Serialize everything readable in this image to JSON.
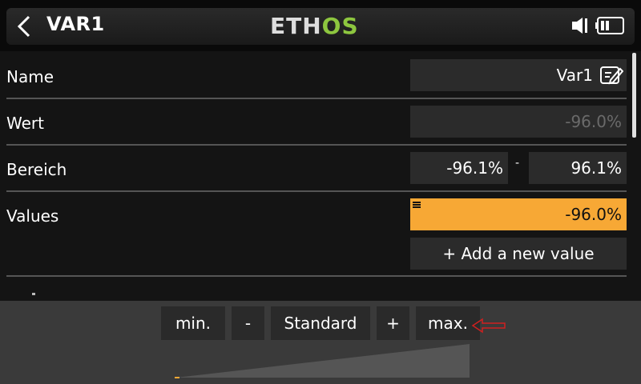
{
  "header": {
    "title": "VAR1",
    "logo": {
      "part1": "ETH",
      "part2": "OS"
    },
    "icons": [
      "back-chevron-icon",
      "speaker-icon",
      "battery-icon"
    ]
  },
  "rows": {
    "name": {
      "label": "Name",
      "value": "Var1",
      "icon": "edit-icon"
    },
    "wert": {
      "label": "Wert",
      "value": "-96.0%"
    },
    "bereich": {
      "label": "Bereich",
      "min": "-96.1%",
      "dash": "-",
      "max": "96.1%"
    },
    "values": {
      "label": "Values",
      "value": "-96.0%",
      "add_label": "+ Add a new value"
    }
  },
  "actions": {
    "min": "min.",
    "minus": "-",
    "standard": "Standard",
    "plus": "+",
    "max": "max."
  },
  "colors": {
    "accent_orange": "#f7a835",
    "logo_green": "#8dc63f",
    "annotation_red": "#d02020"
  }
}
